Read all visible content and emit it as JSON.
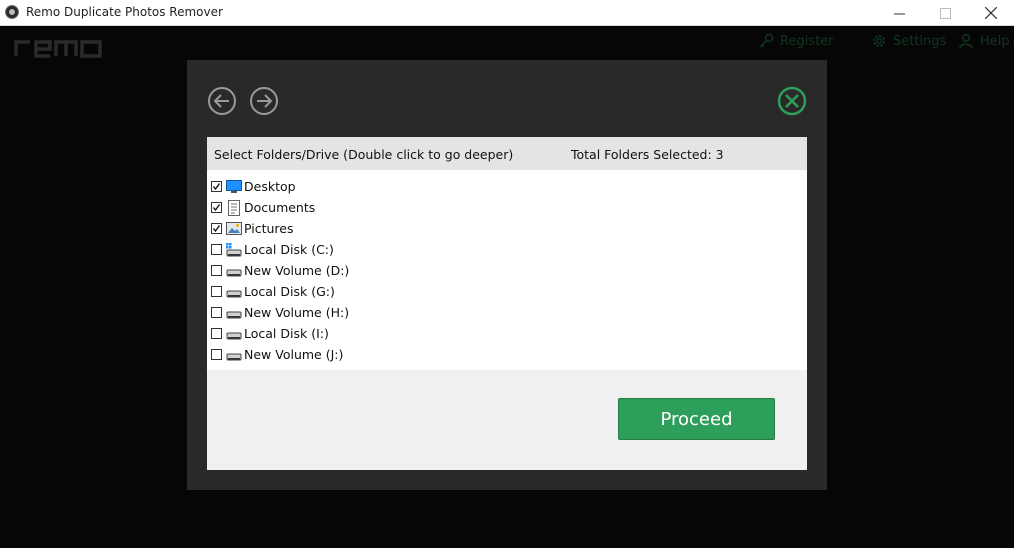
{
  "window": {
    "title": "Remo Duplicate Photos Remover"
  },
  "nav": {
    "register": "Register",
    "settings": "Settings",
    "help": "Help"
  },
  "dialog": {
    "header_left": "Select Folders/Drive (Double click to go deeper)",
    "header_right": "Total Folders Selected: 3",
    "items": [
      {
        "label": "Desktop",
        "checked": true,
        "icon": "desktop-icon"
      },
      {
        "label": "Documents",
        "checked": true,
        "icon": "documents-icon"
      },
      {
        "label": "Pictures",
        "checked": true,
        "icon": "pictures-icon"
      },
      {
        "label": "Local Disk (C:)",
        "checked": false,
        "icon": "system-drive-icon"
      },
      {
        "label": "New Volume (D:)",
        "checked": false,
        "icon": "drive-icon"
      },
      {
        "label": "Local Disk (G:)",
        "checked": false,
        "icon": "drive-icon"
      },
      {
        "label": "New Volume (H:)",
        "checked": false,
        "icon": "drive-icon"
      },
      {
        "label": "Local Disk (I:)",
        "checked": false,
        "icon": "drive-icon"
      },
      {
        "label": "New Volume (J:)",
        "checked": false,
        "icon": "drive-icon"
      }
    ],
    "proceed_label": "Proceed"
  },
  "colors": {
    "accent": "#2e9e5b",
    "modal_bg": "#292929",
    "app_bg": "#060606"
  }
}
